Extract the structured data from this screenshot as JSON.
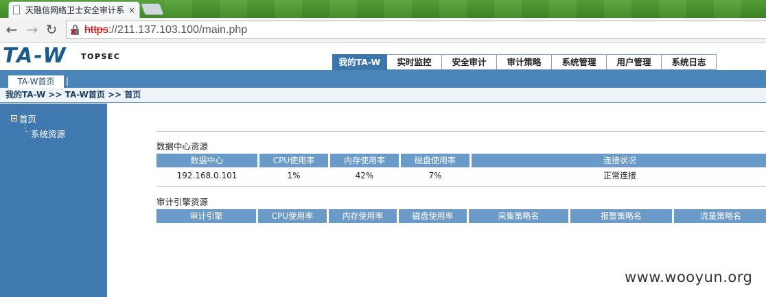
{
  "browser": {
    "tab_title": "天融信网络卫士安全审计系",
    "tab_close": "×",
    "back_icon": "arrow-left-icon",
    "forward_icon": "arrow-right-icon",
    "reload_icon": "reload-icon",
    "url_scheme": "https",
    "url_rest": "://211.137.103.100/main.php"
  },
  "header": {
    "logo": "TA-W",
    "brand": "TOPSEC",
    "nav": [
      {
        "label": "我的TA-W",
        "active": true
      },
      {
        "label": "实时监控"
      },
      {
        "label": "安全审计"
      },
      {
        "label": "审计策略"
      },
      {
        "label": "系统管理"
      },
      {
        "label": "用户管理"
      },
      {
        "label": "系统日志"
      }
    ]
  },
  "subnav": {
    "tab": "TA-W首页",
    "separator": "|"
  },
  "breadcrumb": "我的TA-W >> TA-W首页 >> 首页",
  "sidebar": {
    "root": "首页",
    "child": "系统资源"
  },
  "datacenter": {
    "title": "数据中心资源",
    "headers": [
      "数据中心",
      "CPU使用率",
      "内存使用率",
      "磁盘使用率",
      "连接状况"
    ],
    "rows": [
      [
        "192.168.0.101",
        "1%",
        "42%",
        "7%",
        "正常连接"
      ]
    ]
  },
  "audit_engine": {
    "title": "审计引擎资源",
    "headers": [
      "审计引擎",
      "CPU使用率",
      "内存使用率",
      "磁盘使用率",
      "采集策略名",
      "报警策略名",
      "流量策略名"
    ]
  },
  "watermark": "www.wooyun.org",
  "colors": {
    "primary": "#3b75ab",
    "header_cell": "#6a9ac8",
    "sidebar": "#3f79af"
  }
}
